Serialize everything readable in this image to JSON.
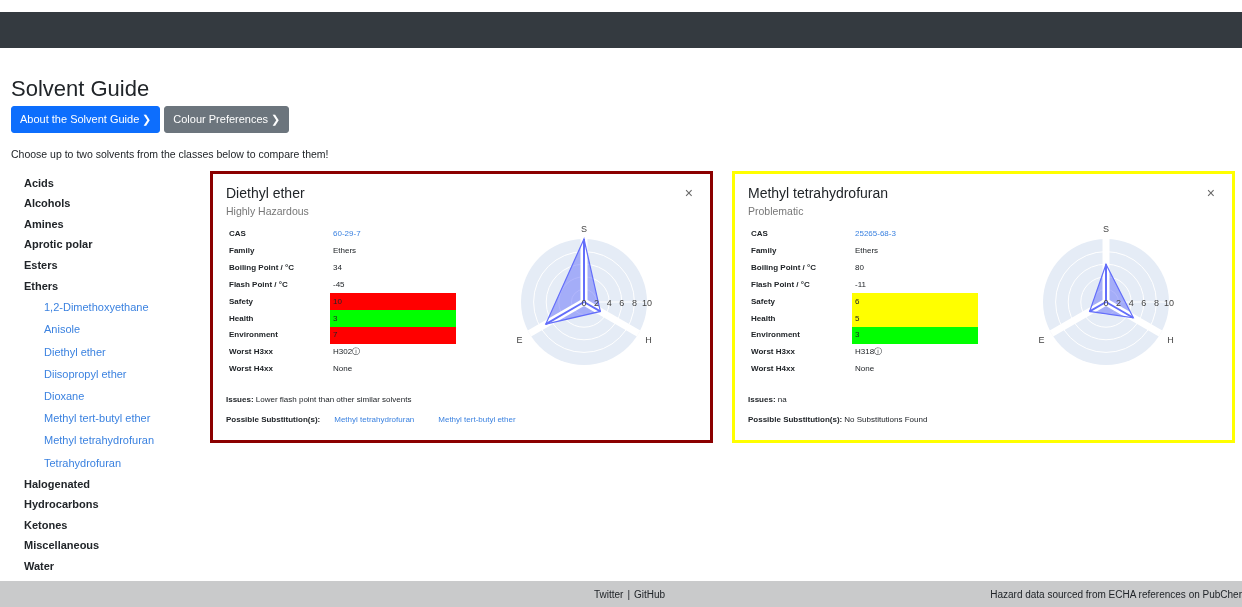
{
  "page": {
    "title": "Solvent Guide",
    "buttons": [
      {
        "label": "About the Solvent Guide ❯",
        "kind": "primary"
      },
      {
        "label": "Colour Preferences ❯",
        "kind": "secondary"
      }
    ],
    "intro": "Choose up to two solvents from the classes below to compare them!"
  },
  "sidebar": {
    "items": [
      {
        "label": "Acids"
      },
      {
        "label": "Alcohols"
      },
      {
        "label": "Amines"
      },
      {
        "label": "Aprotic polar"
      },
      {
        "label": "Esters"
      },
      {
        "label": "Ethers",
        "children": [
          {
            "label": "1,2-Dimethoxyethane"
          },
          {
            "label": "Anisole"
          },
          {
            "label": "Diethyl ether"
          },
          {
            "label": "Diisopropyl ether"
          },
          {
            "label": "Dioxane"
          },
          {
            "label": "Methyl tert-butyl ether"
          },
          {
            "label": "Methyl tetrahydrofuran"
          },
          {
            "label": "Tetrahydrofuran"
          }
        ]
      },
      {
        "label": "Halogenated"
      },
      {
        "label": "Hydrocarbons"
      },
      {
        "label": "Ketones"
      },
      {
        "label": "Miscellaneous"
      },
      {
        "label": "Water"
      }
    ]
  },
  "cards": [
    {
      "name": "Diethyl ether",
      "rating": "Highly Hazardous",
      "color": "#8b0000",
      "close": "×",
      "fields": [
        {
          "label": "CAS",
          "value": "60-29-7",
          "kind": "link"
        },
        {
          "label": "Family",
          "value": "Ethers",
          "kind": "text"
        },
        {
          "label": "Boiling Point / °C",
          "value": "34",
          "kind": "text"
        },
        {
          "label": "Flash Point / °C",
          "value": "-45",
          "kind": "text"
        },
        {
          "label": "Safety",
          "value": "10",
          "kind": "score",
          "color": "#ff0000"
        },
        {
          "label": "Health",
          "value": "3",
          "kind": "score",
          "color": "#00ff00"
        },
        {
          "label": "Environment",
          "value": "7",
          "kind": "score",
          "color": "#ff0000"
        },
        {
          "label": "Worst H3xx",
          "value": "H302ⓘ",
          "kind": "text"
        },
        {
          "label": "Worst H4xx",
          "value": "None",
          "kind": "text"
        }
      ],
      "radar": {
        "axes": [
          {
            "label": "S",
            "level": 1.0
          },
          {
            "label": "H",
            "level": 0.3
          },
          {
            "label": "E",
            "level": 0.7
          }
        ],
        "ticks": [
          "0",
          "2",
          "4",
          "6",
          "8",
          "10"
        ]
      },
      "issues_label": "Issues:",
      "issues": "Lower flash point than other similar solvents",
      "subs_label": "Possible Substitution(s):",
      "substitutions": [
        {
          "label": "Methyl tetrahydrofuran",
          "kind": "link"
        },
        {
          "label": "Methyl tert-butyl ether",
          "kind": "link"
        }
      ]
    },
    {
      "name": "Methyl tetrahydrofuran",
      "rating": "Problematic",
      "color": "#ffff00",
      "close": "×",
      "fields": [
        {
          "label": "CAS",
          "value": "25265-68-3",
          "kind": "link"
        },
        {
          "label": "Family",
          "value": "Ethers",
          "kind": "text"
        },
        {
          "label": "Boiling Point / °C",
          "value": "80",
          "kind": "text"
        },
        {
          "label": "Flash Point / °C",
          "value": "-11",
          "kind": "text"
        },
        {
          "label": "Safety",
          "value": "6",
          "kind": "score",
          "color": "#ffff00"
        },
        {
          "label": "Health",
          "value": "5",
          "kind": "score",
          "color": "#ffff00"
        },
        {
          "label": "Environment",
          "value": "3",
          "kind": "score",
          "color": "#00ff00"
        },
        {
          "label": "Worst H3xx",
          "value": "H318ⓘ",
          "kind": "text"
        },
        {
          "label": "Worst H4xx",
          "value": "None",
          "kind": "text"
        }
      ],
      "radar": {
        "axes": [
          {
            "label": "S",
            "level": 0.6
          },
          {
            "label": "H",
            "level": 0.5
          },
          {
            "label": "E",
            "level": 0.3
          }
        ],
        "ticks": [
          "0",
          "2",
          "4",
          "6",
          "8",
          "10"
        ]
      },
      "issues_label": "Issues:",
      "issues": "na",
      "subs_label": "Possible Substitution(s):",
      "substitutions": [
        {
          "label": "No Substitutions Found",
          "kind": "text"
        }
      ]
    }
  ],
  "footer": {
    "links": [
      "Twitter",
      "GitHub"
    ],
    "separator": "|",
    "source": "Hazard data sourced from ECHA references on PubCher"
  }
}
